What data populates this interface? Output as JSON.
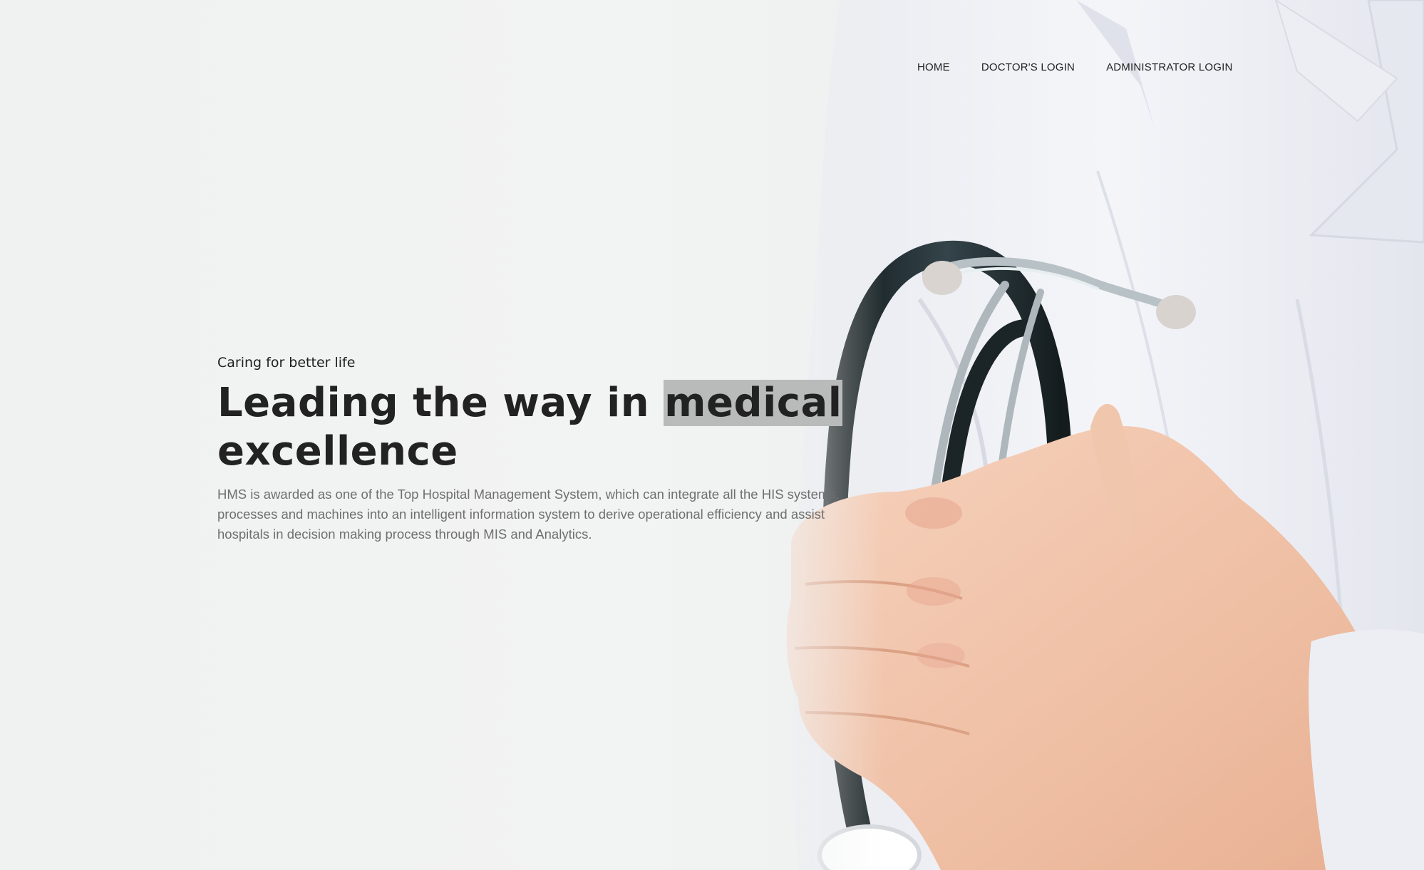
{
  "nav": {
    "items": [
      {
        "label": "HOME"
      },
      {
        "label": "DOCTOR'S LOGIN"
      },
      {
        "label": "ADMINISTRATOR LOGIN"
      }
    ]
  },
  "hero": {
    "tagline": "Caring for better life",
    "headline_part1": "Leading the way in ",
    "headline_highlight": "medical",
    "headline_part2": "excellence",
    "description": "HMS is awarded as one of the Top Hospital Management System, which can integrate all the HIS systems, processes and machines into an intelligent information system to derive operational efficiency and assist hospitals in decision making process through MIS and Analytics."
  },
  "colors": {
    "background": "#f1f2f2",
    "headline": "#222222",
    "highlight": "#b9baba",
    "description": "#6f6f6f",
    "coat": "#eef0f6",
    "stethoscope": "#1f2a2c",
    "skin": "#f1c3a8"
  }
}
